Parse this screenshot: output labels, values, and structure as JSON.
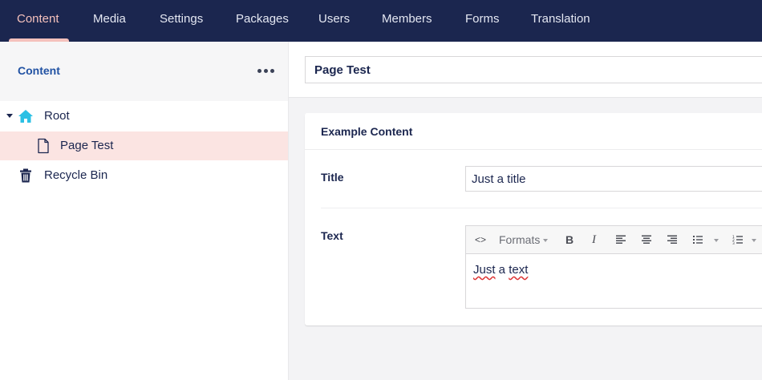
{
  "nav": {
    "tabs": [
      {
        "label": "Content",
        "active": true
      },
      {
        "label": "Media"
      },
      {
        "label": "Settings"
      },
      {
        "label": "Packages"
      },
      {
        "label": "Users"
      },
      {
        "label": "Members"
      },
      {
        "label": "Forms"
      },
      {
        "label": "Translation"
      }
    ]
  },
  "sidebar": {
    "title": "Content",
    "tree": [
      {
        "label": "Root",
        "icon": "home-icon",
        "expanded": true
      },
      {
        "label": "Page Test",
        "icon": "document-icon",
        "selected": true
      },
      {
        "label": "Recycle Bin",
        "icon": "trash-icon"
      }
    ]
  },
  "editor": {
    "node_name": "Page Test",
    "group": {
      "title": "Example Content",
      "properties": {
        "title": {
          "label": "Title",
          "value": "Just a title"
        },
        "text": {
          "label": "Text",
          "toolbar": {
            "source": "<>",
            "formats": "Formats",
            "bold": "B",
            "italic": "I"
          },
          "content_words": [
            "Just",
            " a ",
            "text"
          ]
        }
      }
    }
  },
  "colors": {
    "nav_bg": "#1b264f",
    "nav_active": "#f5c1bc",
    "selected_row": "#fbe4e2",
    "home_icon": "#2bc0e4"
  }
}
